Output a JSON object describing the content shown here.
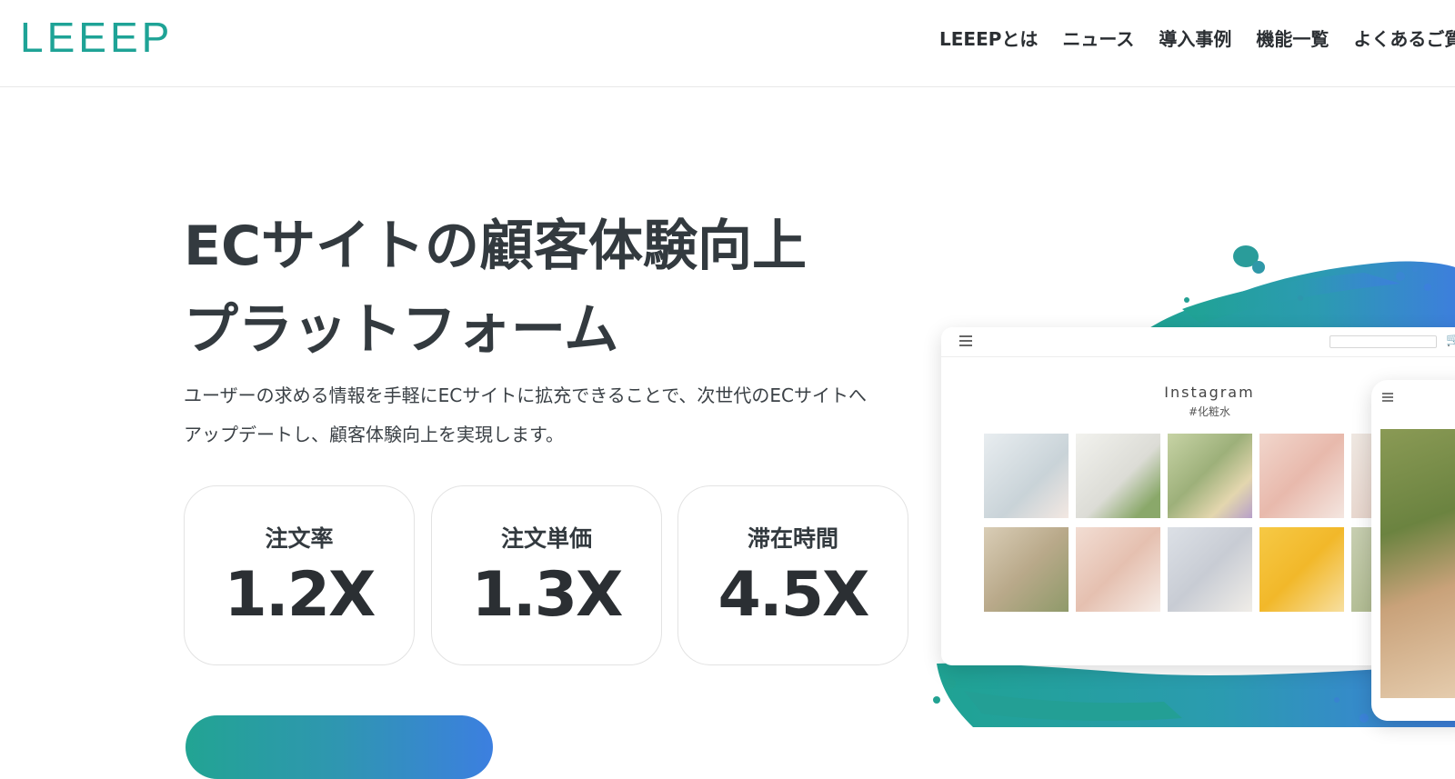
{
  "header": {
    "logo": "LEEEP",
    "nav": [
      "LEEEPとは",
      "ニュース",
      "導入事例",
      "機能一覧",
      "よくあるご質"
    ]
  },
  "hero": {
    "title_line1": "ECサイトの顧客体験向上",
    "title_line2": "プラットフォーム",
    "desc_line1": "ユーザーの求める情報を手軽にECサイトに拡充できることで、次世代のECサイトへ",
    "desc_line2": "アップデートし、顧客体験向上を実現します。"
  },
  "stats": [
    {
      "label": "注文率",
      "value": "1.2X"
    },
    {
      "label": "注文単価",
      "value": "1.3X"
    },
    {
      "label": "滞在時間",
      "value": "4.5X"
    }
  ],
  "mockup": {
    "instagram_title": "Instagram",
    "instagram_tag": "#化粧水"
  },
  "colors": {
    "brand": "#1ea396",
    "gradient_start": "#22a493",
    "gradient_end": "#3c7fe0"
  }
}
